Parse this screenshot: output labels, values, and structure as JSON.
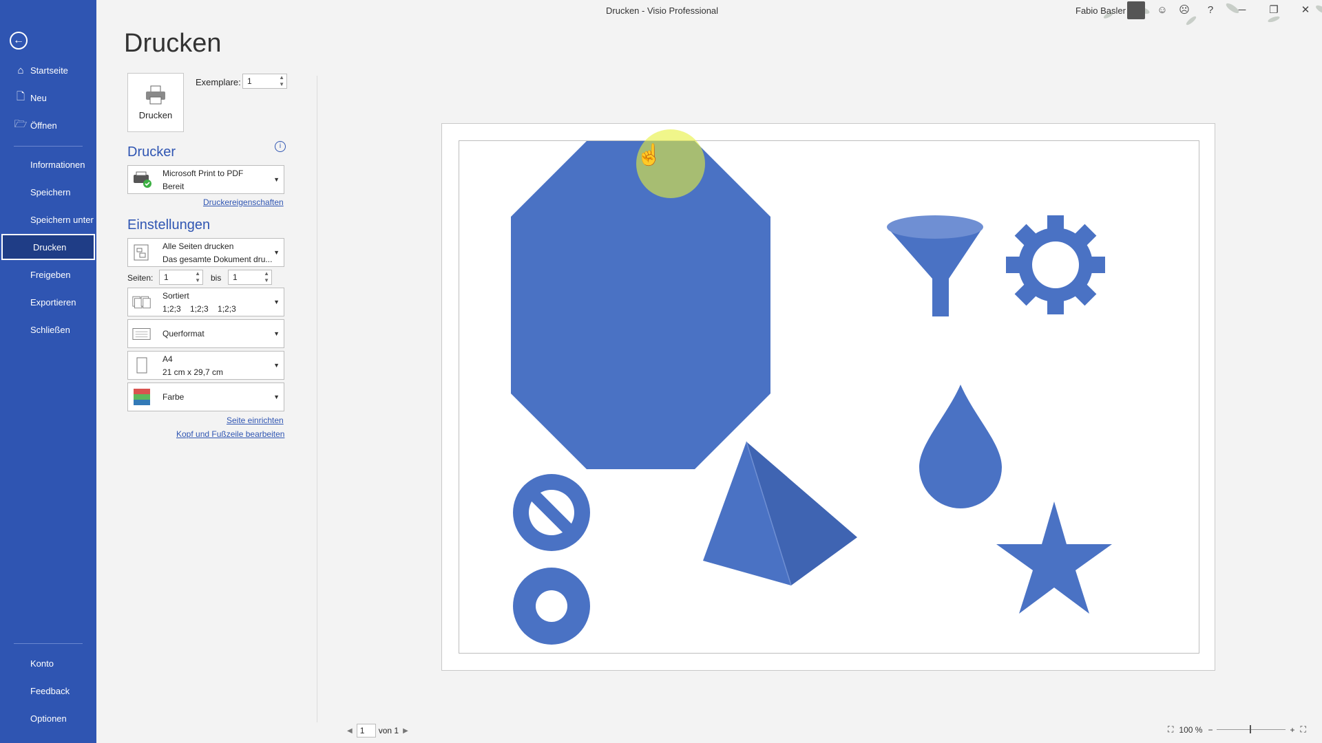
{
  "window": {
    "title": "Drucken  -  Visio Professional",
    "user": "Fabio Basler",
    "buttons": [
      "☺",
      "☹",
      "?",
      "─",
      "❐",
      "✕"
    ]
  },
  "sidebar": {
    "items": [
      {
        "label": "Startseite",
        "icon": "home-icon"
      },
      {
        "label": "Neu",
        "icon": "new-document-icon"
      },
      {
        "label": "Öffnen",
        "icon": "open-folder-icon"
      },
      {
        "label": "Informationen"
      },
      {
        "label": "Speichern"
      },
      {
        "label": "Speichern unter"
      },
      {
        "label": "Drucken",
        "active": true
      },
      {
        "label": "Freigeben"
      },
      {
        "label": "Exportieren"
      },
      {
        "label": "Schließen"
      }
    ],
    "bottom": [
      {
        "label": "Konto"
      },
      {
        "label": "Feedback"
      },
      {
        "label": "Optionen"
      }
    ]
  },
  "print": {
    "page_title": "Drucken",
    "print_button": "Drucken",
    "copies_label": "Exemplare:",
    "copies_value": "1",
    "printer_section": "Drucker",
    "printer_name": "Microsoft Print to PDF",
    "printer_status": "Bereit",
    "printer_properties": "Druckereigenschaften",
    "settings_section": "Einstellungen",
    "pages_scope_title": "Alle Seiten drucken",
    "pages_scope_sub": "Das gesamte Dokument dru...",
    "pages_label": "Seiten:",
    "pages_from": "1",
    "pages_to_label": "bis",
    "pages_to": "1",
    "collate_title": "Sortiert",
    "collate_sub": "1;2;3    1;2;3    1;2;3",
    "orientation": "Querformat",
    "paper_title": "A4",
    "paper_sub": "21 cm x 29,7 cm",
    "color": "Farbe",
    "page_setup_link": "Seite einrichten",
    "header_footer_link": "Kopf und Fußzeile bearbeiten"
  },
  "preview": {
    "shape_color": "#4a72c4",
    "shapes": [
      "octagon",
      "funnel",
      "gear",
      "drop",
      "no-symbol",
      "donut",
      "pyramid",
      "star"
    ]
  },
  "footer": {
    "page_value": "1",
    "page_of": "von 1",
    "zoom": "100 %"
  }
}
